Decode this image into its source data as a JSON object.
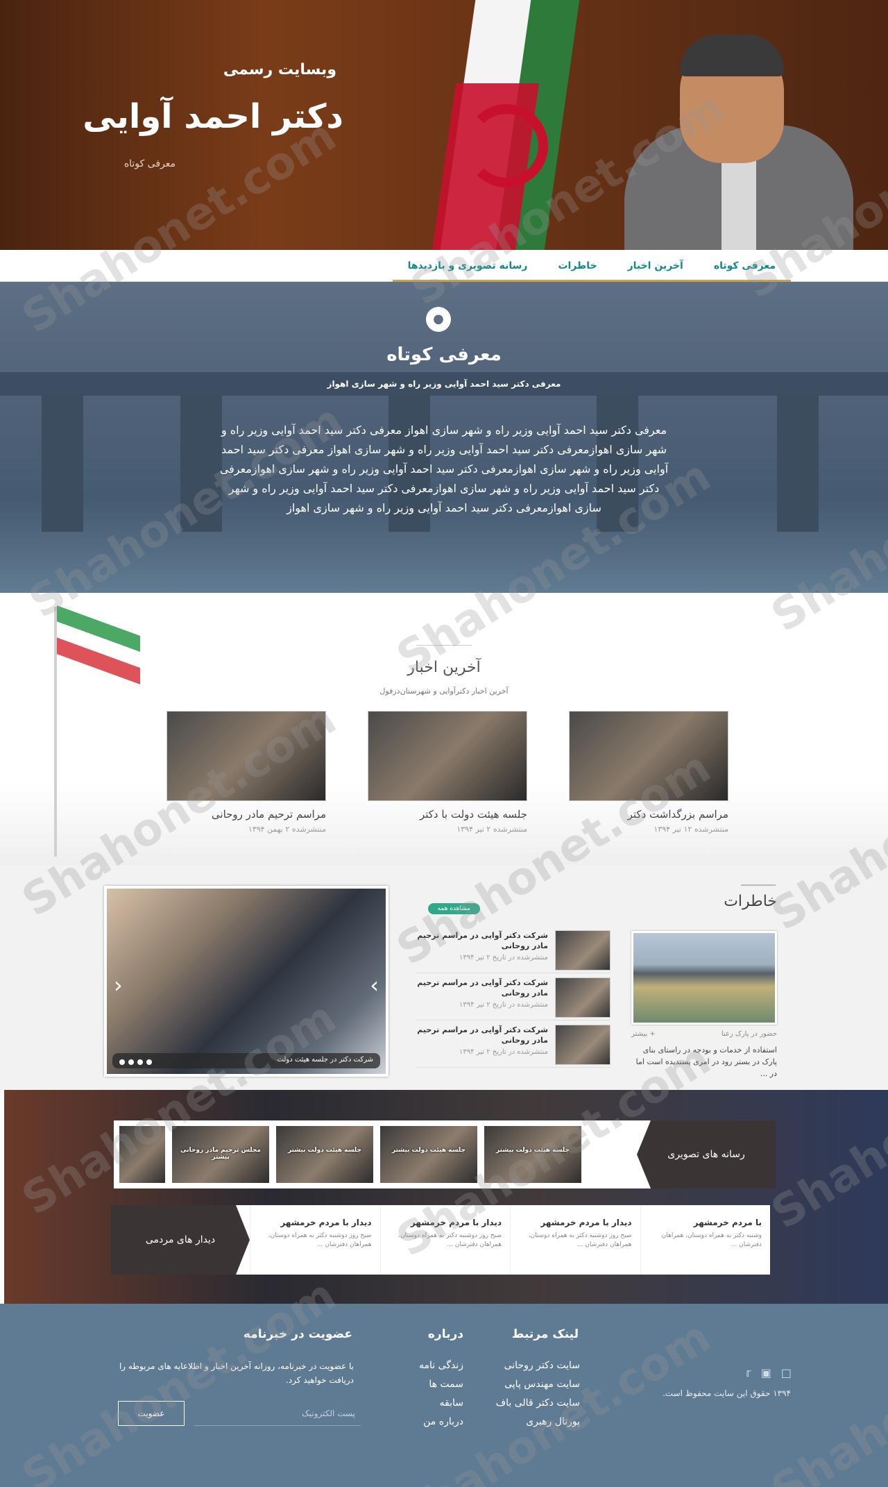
{
  "hero": {
    "subtitle": "وبسایت رسمی",
    "title": "دکتر احمد آوایی",
    "intro_link": "معرفی کوتاه"
  },
  "nav": {
    "items": [
      {
        "label": "معرفی کوتاه"
      },
      {
        "label": "آخرین اخبار"
      },
      {
        "label": "خاطرات"
      },
      {
        "label": "رسانه تصویری و بازدیدها"
      }
    ]
  },
  "intro": {
    "icon": "lightbulb-icon",
    "heading": "معرفی کوتاه",
    "tagline": "معرفی دکتر سید احمد آوایی وزیر راه و شهر سازی اهواز",
    "body": "معرفی دکتر سید احمد آوایی وزیر راه و شهر سازی اهواز معرفی دکتر سید احمد آوایی وزیر راه و شهر سازی اهوازمعرفی دکتر سید احمد آوایی وزیر راه و شهر سازی اهواز معرفی دکتر سید احمد آوایی وزیر راه و شهر سازی اهوازمعرفی دکتر سید احمد آوایی وزیر راه و شهر سازی اهوازمعرفی دکتر سید احمد آوایی وزیر راه و شهر سازی اهوازمعرفی دکتر سید احمد آوایی وزیر راه و شهر سازی اهوازمعرفی دکتر سید احمد آوایی وزیر راه و شهر سازی اهواز"
  },
  "news": {
    "heading": "آخرین اخبار",
    "subheading": "آخرین اخبار دکترآوایی و شهرستان‌دزفول",
    "cards": [
      {
        "title": "مراسم بزرگداشت دکتر",
        "meta": "منتشرشده ۱۲ تیر ۱۳۹۴"
      },
      {
        "title": "جلسه هیئت دولت با دکتر",
        "meta": "منتشرشده ۲ تیر ۱۳۹۴"
      },
      {
        "title": "مراسم ترحیم مادر روحانی",
        "meta": "منتشرشده ۲ بهمن ۱۳۹۴"
      }
    ]
  },
  "memories": {
    "heading": "خاطرات",
    "see_all": "مشاهده همه",
    "featured": {
      "meta_left": "حضور در پارک رعنا",
      "more": "+ بیشتر",
      "desc": "استفاده از خدمات و بودجه در راستای بنای پارک در بستر رود در امری پسندیده است اما در ..."
    },
    "items": [
      {
        "title": "شرکت دکتر آوایی در مراسم ترحیم مادر روحانی",
        "meta": "منتشرشده در تاریخ ۲ تیر ۱۳۹۴"
      },
      {
        "title": "شرکت دکتر آوایی در مراسم ترحیم مادر روحانی",
        "meta": "منتشرشده در تاریخ ۲ تیر ۱۳۹۴"
      },
      {
        "title": "شرکت دکتر آوایی در مراسم ترحیم مادر روحانی",
        "meta": "منتشرشده در تاریخ ۲ تیر ۱۳۹۴"
      }
    ],
    "slider_caption": "شرکت دکتر در جلسه هیئت دولت"
  },
  "media": {
    "gallery_label": "رسانه های تصویری",
    "thumbs": [
      {
        "label": "جلسه هیئت دولت بیشتر"
      },
      {
        "label": "جلسه هیئت دولت بیشتر"
      },
      {
        "label": "جلسه هیئت دولت بیشتر"
      },
      {
        "label": "مجلس ترحیم مادر روحانی بیشتر"
      },
      {
        "label": ""
      }
    ],
    "visits_label": "دیدار های مردمی",
    "visits": [
      {
        "title": "با مردم خرمشهر",
        "desc": "وشنبه دکتر به همراه دوستان، همراهان دفترشان ..."
      },
      {
        "title": "دیدار با مردم خرمشهر",
        "desc": "صبح روز دوشنبه دکتر به همراه دوستان، همراهان دفترشان ..."
      },
      {
        "title": "دیدار با مردم خرمشهر",
        "desc": "صبح روز دوشنبه دکتر به همراه دوستان، همراهان دفترشان ..."
      },
      {
        "title": "دیدار با مردم خرمشهر",
        "desc": "صبح روز دوشنبه دکتر به همراه دوستان، همراهان دفترشان ..."
      }
    ]
  },
  "footer": {
    "links_heading": "لینک مرتبط",
    "links": [
      "سایت دکتر روحانی",
      "سایت مهندس پاپی",
      "سایت دکتر قالی باف",
      "پورتال رهبری"
    ],
    "about_heading": "درباره",
    "about": [
      "زندگی نامه",
      "سمت ها",
      "سابقه",
      "درباره من"
    ],
    "newsletter_heading": "عضویت در خبرنامه",
    "newsletter_text": "با عضویت در خبرنامه، روزانه آخرین اخبار و اطلاعایه های مربوطه را دریافت خواهید کرد.",
    "email_placeholder": "پست الکترونیک",
    "join_label": "عضویت",
    "copyright": "۱۳۹۴ حقوق این سایت محفوظ است.",
    "social": [
      "facebook-icon",
      "instagram-icon",
      "twitter-icon"
    ]
  },
  "watermark": "Shahonet.com"
}
